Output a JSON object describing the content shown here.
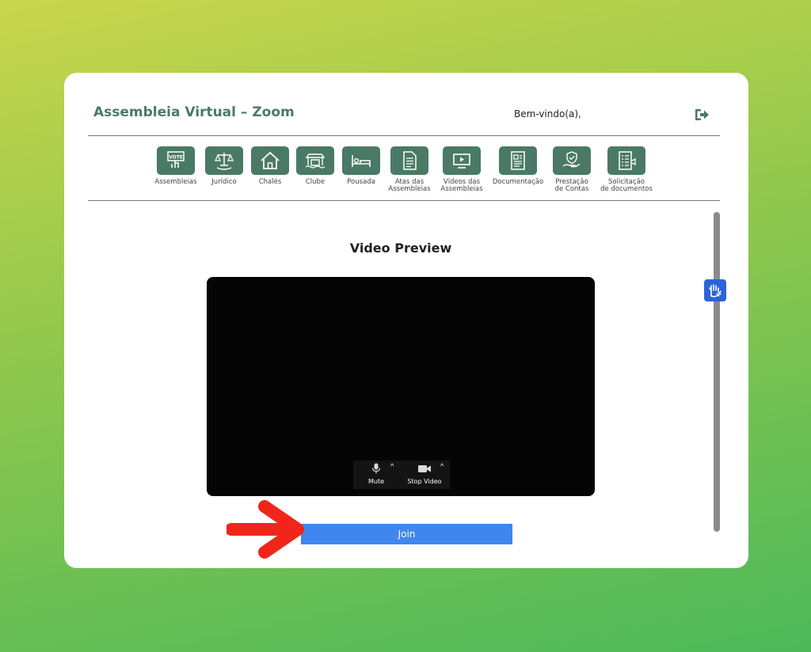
{
  "header": {
    "title": "Assembleia Virtual – Zoom",
    "welcome": "Bem-vindo(a),"
  },
  "nav": {
    "items": [
      {
        "line1": "Assembleias",
        "line2": "",
        "icon": "vote-icon"
      },
      {
        "line1": "Jurídico",
        "line2": "",
        "icon": "scales-icon"
      },
      {
        "line1": "Chalés",
        "line2": "",
        "icon": "house-icon"
      },
      {
        "line1": "Clube",
        "line2": "",
        "icon": "club-icon"
      },
      {
        "line1": "Pousada",
        "line2": "",
        "icon": "bed-icon"
      },
      {
        "line1": "Atas das",
        "line2": "Assembleias",
        "icon": "document-icon"
      },
      {
        "line1": "Vídeos das",
        "line2": "Assembleias",
        "icon": "video-play-icon"
      },
      {
        "line1": "Documentação",
        "line2": "",
        "icon": "folder-doc-icon"
      },
      {
        "line1": "Prestação",
        "line2": "de Contas",
        "icon": "hand-shield-icon"
      },
      {
        "line1": "Solicitação",
        "line2": "de documentos",
        "icon": "checklist-icon"
      }
    ],
    "icon_badge": "VOTE"
  },
  "main": {
    "preview_title": "Video Preview",
    "controls": {
      "mute_label": "Mute",
      "stop_video_label": "Stop Video"
    },
    "join_label": "Join"
  },
  "colors": {
    "brand_green": "#4a7a66",
    "join_blue": "#3f86ee",
    "annotation_red": "#f0261b",
    "accessibility_blue": "#2b63d9"
  }
}
